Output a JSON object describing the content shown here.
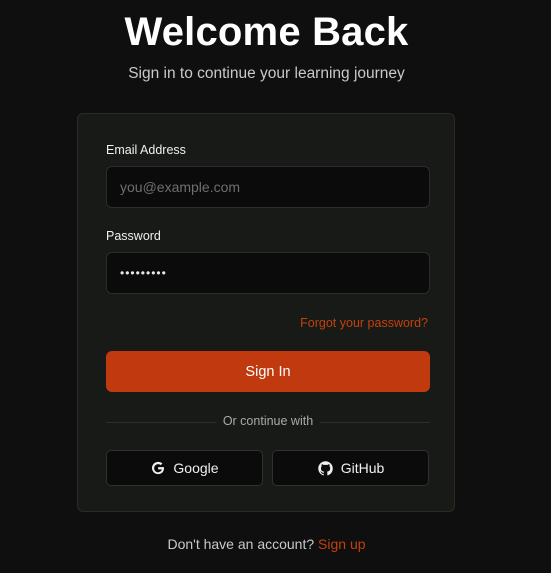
{
  "header": {
    "title": "Welcome Back",
    "subtitle": "Sign in to continue your learning journey"
  },
  "form": {
    "email_label": "Email Address",
    "email_placeholder": "you@example.com",
    "email_value": "",
    "password_label": "Password",
    "password_value": "•••••••••",
    "forgot_link": "Forgot your password?",
    "submit_label": "Sign In",
    "divider_text": "Or continue with"
  },
  "social": {
    "google_label": "Google",
    "github_label": "GitHub"
  },
  "footer": {
    "prompt": "Don't have an account?",
    "signup_link": "Sign up"
  },
  "colors": {
    "background": "#0f0f0f",
    "card": "#181a17",
    "accent": "#c0390f",
    "link": "#c2410c"
  },
  "icons": [
    "google-icon",
    "github-icon"
  ]
}
